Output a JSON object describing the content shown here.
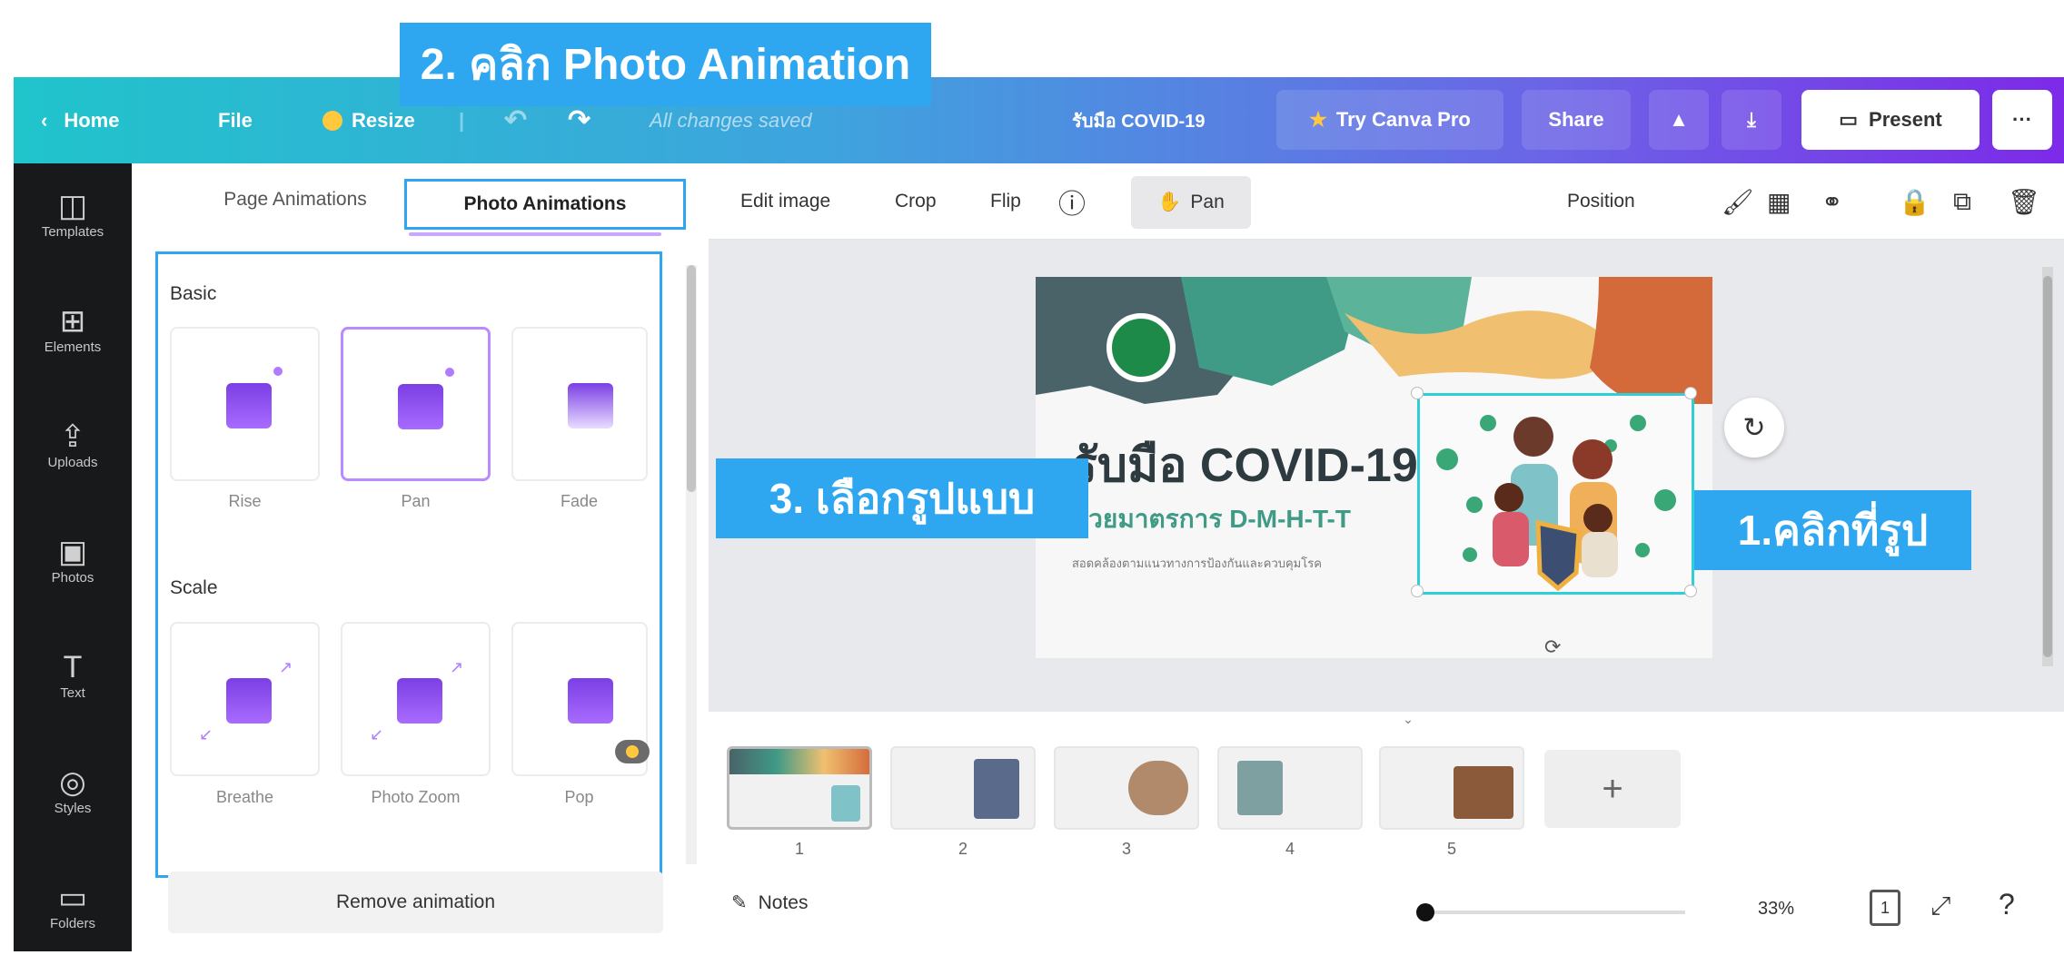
{
  "callouts": {
    "step2": "2. คลิก Photo Animation",
    "step3": "3. เลือกรูปแบบ",
    "step1": "1.คลิกที่รูป"
  },
  "topbar": {
    "home": "Home",
    "file": "File",
    "resize": "Resize",
    "saved": "All changes saved",
    "title": "รับมือ COVID-19",
    "try_pro": "Try Canva Pro",
    "share": "Share",
    "present": "Present",
    "more": "···"
  },
  "rail": {
    "items": [
      {
        "label": "Templates",
        "icon": "templates-icon"
      },
      {
        "label": "Elements",
        "icon": "elements-icon"
      },
      {
        "label": "Uploads",
        "icon": "uploads-icon"
      },
      {
        "label": "Photos",
        "icon": "photos-icon"
      },
      {
        "label": "Text",
        "icon": "text-icon"
      },
      {
        "label": "Styles",
        "icon": "styles-icon"
      },
      {
        "label": "Folders",
        "icon": "folder-icon"
      }
    ]
  },
  "panel": {
    "tab_page": "Page Animations",
    "tab_photo": "Photo Animations",
    "section_basic": "Basic",
    "section_scale": "Scale",
    "basic": [
      "Rise",
      "Pan",
      "Fade"
    ],
    "scale": [
      "Breathe",
      "Photo Zoom",
      "Pop"
    ],
    "remove": "Remove animation"
  },
  "toolbar": {
    "edit_image": "Edit image",
    "crop": "Crop",
    "flip": "Flip",
    "pan": "Pan",
    "position": "Position"
  },
  "slide": {
    "heading": "รับมือ COVID-19",
    "subheading": "ด้วยมาตรการ D-M-H-T-T",
    "body": "สอดคล้องตามแนวทางการป้องกันและควบคุมโรค"
  },
  "pages": [
    "1",
    "2",
    "3",
    "4",
    "5"
  ],
  "add_page": "+",
  "bottom": {
    "notes": "Notes",
    "zoom": "33%",
    "page_count": "1"
  },
  "colors": {
    "accent_blue": "#2ea6f0",
    "brand_purple": "#7d2ae8",
    "teal": "#20c4cb"
  }
}
